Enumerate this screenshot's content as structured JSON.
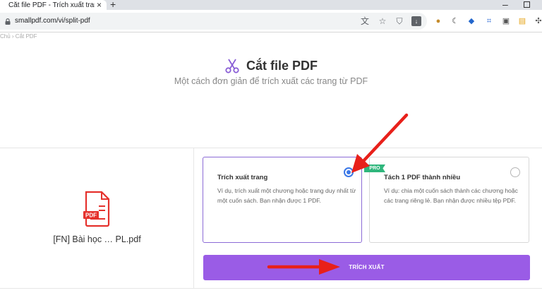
{
  "browser": {
    "tab_title": "Cắt file PDF - Trích xuất trang",
    "tab_close": "×",
    "new_tab": "+",
    "url": "smallpdf.com/vi/split-pdf",
    "window_minimize": "–"
  },
  "breadcrumb": "Chủ › Cắt PDF",
  "header": {
    "title": "Cắt file PDF",
    "subtitle": "Một cách đơn giản để trích xuất các trang từ PDF"
  },
  "file": {
    "name": "[FN] Bài học … PL.pdf",
    "icon_label": "PDF"
  },
  "options": [
    {
      "title": "Trích xuất trang",
      "description": "Ví dụ, trích xuất một chương hoặc trang duy nhất từ một cuốn sách. Bạn nhận được 1 PDF.",
      "selected": true
    },
    {
      "title": "Tách 1 PDF thành nhiều",
      "description": "Ví dụ: chia một cuốn sách thành các chương hoặc các trang riêng lẻ. Bạn nhận được nhiều tệp PDF.",
      "badge": "PRO",
      "selected": false
    }
  ],
  "action_button": "TRÍCH XUẤT",
  "colors": {
    "accent": "#9a5ce6",
    "selected_border": "#8c6bd6",
    "radio": "#3b78e7",
    "pro_badge": "#2fb67c",
    "pdf_red": "#e5322d",
    "annotation_arrow": "#e8201a"
  }
}
